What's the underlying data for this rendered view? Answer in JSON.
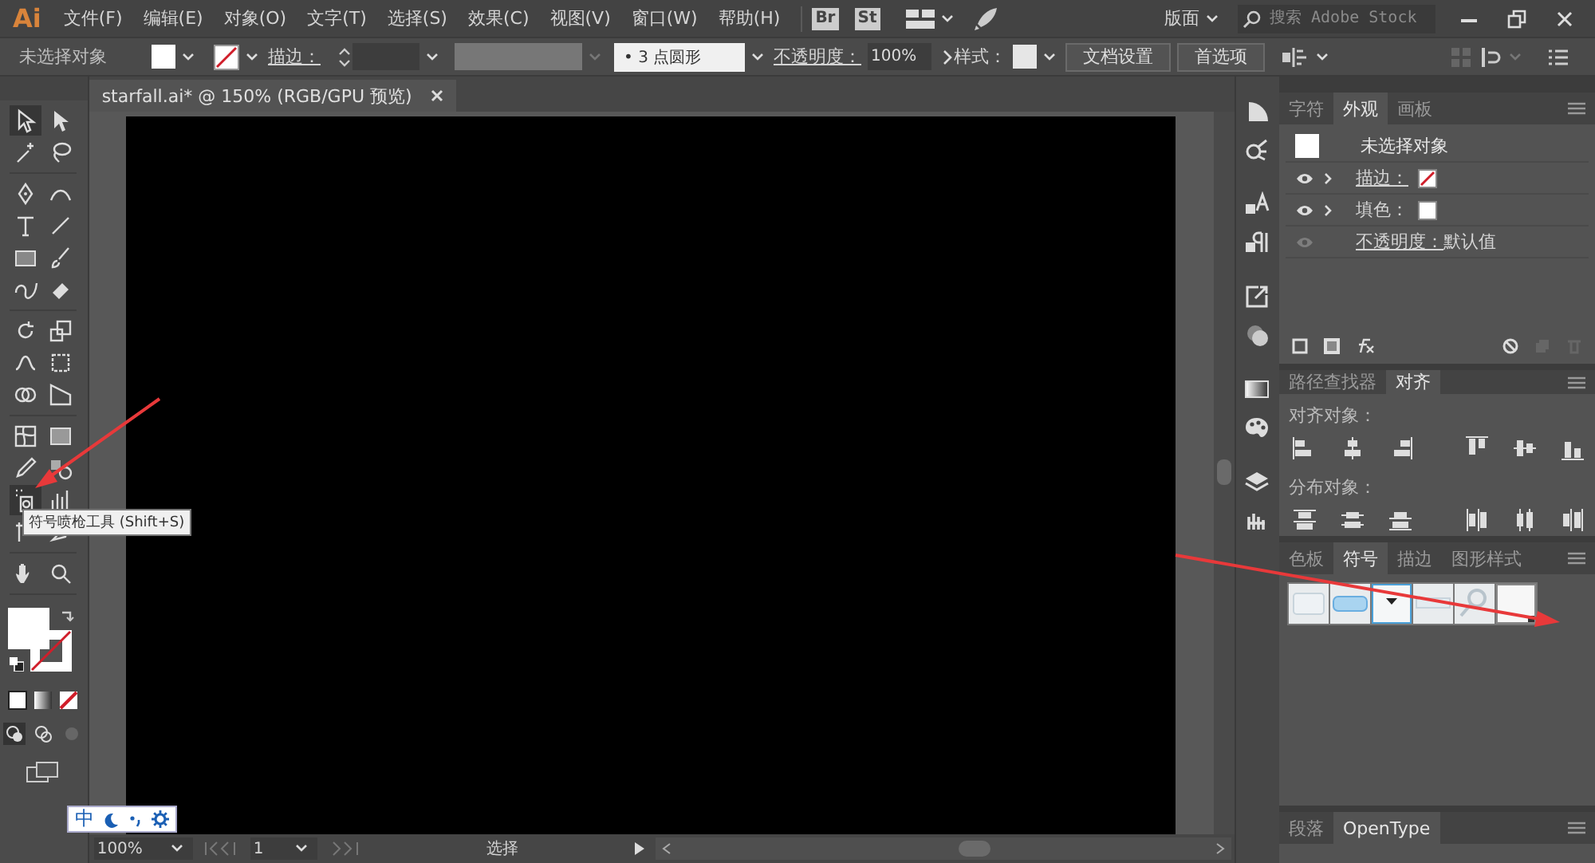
{
  "app_logo": "Ai",
  "menu": [
    "文件(F)",
    "编辑(E)",
    "对象(O)",
    "文字(T)",
    "选择(S)",
    "效果(C)",
    "视图(V)",
    "窗口(W)",
    "帮助(H)"
  ],
  "app_buttons": [
    "Br",
    "St"
  ],
  "workspace": "版面",
  "search": {
    "placeholder": "搜索 Adobe Stock"
  },
  "control_bar": {
    "selection": "未选择对象",
    "stroke_label": "描边：",
    "brush": "•  3 点圆形",
    "opacity_label": "不透明度：",
    "opacity": "100%",
    "style_label": "样式：",
    "buttons": [
      "文档设置",
      "首选项"
    ]
  },
  "document_tab": {
    "title": "starfall.ai* @ 150% (RGB/GPU 预览)"
  },
  "tool_groups": [
    {
      "tools": [
        {
          "kind": "selection",
          "selected": true
        },
        {
          "kind": "direct-selection",
          "selected": false
        },
        {
          "kind": "magic-wand",
          "selected": false
        },
        {
          "kind": "lasso",
          "selected": false
        }
      ]
    },
    {
      "tools": [
        {
          "kind": "pen",
          "selected": false
        },
        {
          "kind": "curvature",
          "selected": false
        },
        {
          "kind": "type",
          "selected": false
        },
        {
          "kind": "line",
          "selected": false
        },
        {
          "kind": "rectangle",
          "selected": false
        },
        {
          "kind": "paintbrush",
          "selected": false
        },
        {
          "kind": "shaper",
          "selected": false
        },
        {
          "kind": "eraser",
          "selected": false
        }
      ]
    },
    {
      "tools": [
        {
          "kind": "rotate",
          "selected": false
        },
        {
          "kind": "scale",
          "selected": false
        },
        {
          "kind": "warp",
          "selected": false
        },
        {
          "kind": "free-transform",
          "selected": false
        },
        {
          "kind": "shape-builder",
          "selected": false
        },
        {
          "kind": "perspective",
          "selected": false
        }
      ]
    },
    {
      "tools": [
        {
          "kind": "mesh",
          "selected": false
        },
        {
          "kind": "gradient",
          "selected": false
        },
        {
          "kind": "eyedropper",
          "selected": false
        },
        {
          "kind": "blend",
          "selected": false
        },
        {
          "kind": "symbol-sprayer",
          "selected": true
        },
        {
          "kind": "column-graph",
          "selected": false
        },
        {
          "kind": "artboard",
          "selected": false
        },
        {
          "kind": "slice",
          "selected": false
        }
      ]
    },
    {
      "tools": [
        {
          "kind": "hand",
          "selected": false
        },
        {
          "kind": "zoom",
          "selected": false
        }
      ]
    }
  ],
  "tooltip": "符号喷枪工具 (Shift+S)",
  "appearance_panel": {
    "tabs": [
      {
        "label": "字符",
        "selected": false
      },
      {
        "label": "外观",
        "selected": true
      },
      {
        "label": "画板",
        "selected": false
      }
    ],
    "title": "未选择对象",
    "rows": [
      {
        "kind": "stroke",
        "label": "描边：",
        "link": true,
        "visible": true,
        "expandable": true
      },
      {
        "kind": "fill",
        "label": "填色：",
        "link": false,
        "visible": true,
        "expandable": true
      },
      {
        "kind": "opacity",
        "label": "不透明度：",
        "value": "默认值",
        "link": true,
        "visible": false,
        "expandable": false
      }
    ]
  },
  "align_panel": {
    "tabs": [
      {
        "label": "路径查找器",
        "selected": false
      },
      {
        "label": "对齐",
        "selected": true
      }
    ],
    "sections": [
      {
        "kind": "align",
        "label": "对齐对象："
      },
      {
        "kind": "distribute",
        "label": "分布对象："
      }
    ]
  },
  "symbols_panel": {
    "tabs": [
      {
        "label": "色板",
        "selected": false
      },
      {
        "label": "符号",
        "selected": true
      },
      {
        "label": "描边",
        "selected": false
      },
      {
        "label": "图形样式",
        "selected": false
      }
    ],
    "symbols": [
      {
        "kind": "panel"
      },
      {
        "kind": "pill"
      },
      {
        "kind": "dropdown"
      },
      {
        "kind": "bar"
      },
      {
        "kind": "magnifier"
      },
      {
        "kind": "blank"
      }
    ]
  },
  "bottom_panel": {
    "tabs": [
      {
        "label": "段落",
        "selected": false
      },
      {
        "label": "OpenType",
        "selected": true
      }
    ]
  },
  "status_bar": {
    "zoom": "100%",
    "artboard": "1",
    "tool": "选择"
  },
  "ime_bar": {
    "language": "中"
  }
}
